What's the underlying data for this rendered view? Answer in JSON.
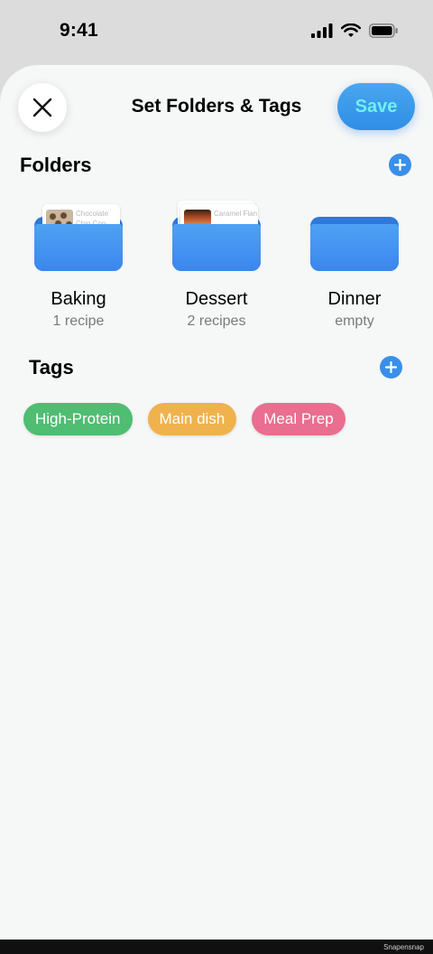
{
  "status_bar": {
    "time": "9:41"
  },
  "header": {
    "title": "Set Folders & Tags",
    "save_label": "Save"
  },
  "folders_section": {
    "title": "Folders",
    "items": [
      {
        "name": "Baking",
        "count": "1 recipe",
        "preview_text": "Chocolate Chip Coo...",
        "preview_color": "#c8b8a0"
      },
      {
        "name": "Dessert",
        "count": "2 recipes",
        "preview_text": "Caramel Flan",
        "preview_color": "#b8532a"
      },
      {
        "name": "Dinner",
        "count": "empty"
      }
    ]
  },
  "tags_section": {
    "title": "Tags",
    "items": [
      {
        "label": "High-Protein",
        "color": "#4fbd72"
      },
      {
        "label": "Main dish",
        "color": "#f0b24c"
      },
      {
        "label": "Meal Prep",
        "color": "#ea6e8f"
      }
    ]
  },
  "watermark": "Snapensnap",
  "colors": {
    "accent": "#3a8fe8",
    "save_text": "#6ff0f2",
    "background": "#f6f7f7"
  }
}
